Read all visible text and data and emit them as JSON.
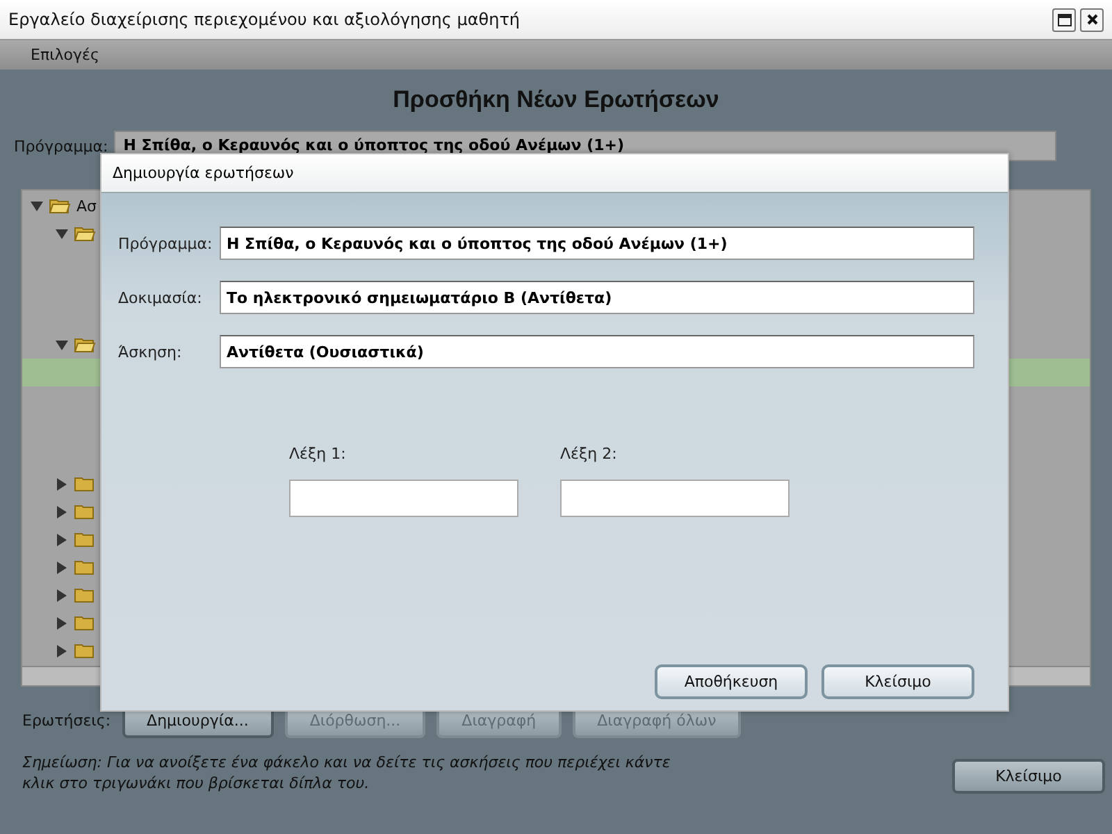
{
  "window": {
    "title": "Εργαλείο διαχείρισης περιεχομένου και αξιολόγησης μαθητή"
  },
  "menu": [
    "Επιλογές"
  ],
  "heading": "Προσθήκη Νέων Ερωτήσεων",
  "program": {
    "label": "Πρόγραμμα:",
    "value": "Η Σπίθα, ο Κεραυνός και ο ύποπτος της οδού Ανέμων (1+)"
  },
  "tree": [
    {
      "label": "Ασ",
      "expanded": true,
      "selected": false,
      "children": [
        {
          "expanded": true,
          "selected": false,
          "children": [
            {
              "selected": false
            },
            {
              "selected": false
            },
            {
              "selected": false
            }
          ]
        },
        {
          "expanded": true,
          "selected": false,
          "children": [
            {
              "selected": true
            },
            {
              "selected": false
            },
            {
              "selected": false
            },
            {
              "selected": false
            }
          ]
        },
        {
          "expanded": false,
          "selected": false
        },
        {
          "expanded": false,
          "selected": false
        },
        {
          "expanded": false,
          "selected": false
        },
        {
          "expanded": false,
          "selected": false
        },
        {
          "expanded": false,
          "selected": false
        },
        {
          "expanded": false,
          "selected": false
        },
        {
          "expanded": false,
          "selected": false
        }
      ]
    }
  ],
  "questions": {
    "label": "Ερωτήσεις:",
    "buttons": [
      {
        "label": "Δημιουργία...",
        "disabled": false
      },
      {
        "label": "Διόρθωση...",
        "disabled": true
      },
      {
        "label": "Διαγραφή",
        "disabled": true
      },
      {
        "label": "Διαγραφή όλων",
        "disabled": true
      }
    ]
  },
  "note": "*Σημείωση: Για να ανοίξετε ένα φάκελο και να δείτε τις ασκήσεις που περιέχει κάντε κλικ στο τριγωνάκι που βρίσκεται δίπλα του.*",
  "close_button": "Κλείσιμο",
  "dialog": {
    "title": "Δημιουργία ερωτήσεων",
    "fields": [
      {
        "label": "Πρόγραμμα:",
        "value": "Η Σπίθα, ο Κεραυνός και ο ύποπτος της οδού Ανέμων (1+)"
      },
      {
        "label": "Δοκιμασία:",
        "value": "Το ηλεκτρονικό σημειωματάριο Β (Αντίθετα)"
      },
      {
        "label": "Άσκηση:",
        "value": "Αντίθετα (Ουσιαστικά)"
      }
    ],
    "words": [
      {
        "label": "Λέξη 1:"
      },
      {
        "label": "Λέξη 2:"
      }
    ],
    "buttons": [
      "Αποθήκευση",
      "Κλείσιμο"
    ]
  }
}
